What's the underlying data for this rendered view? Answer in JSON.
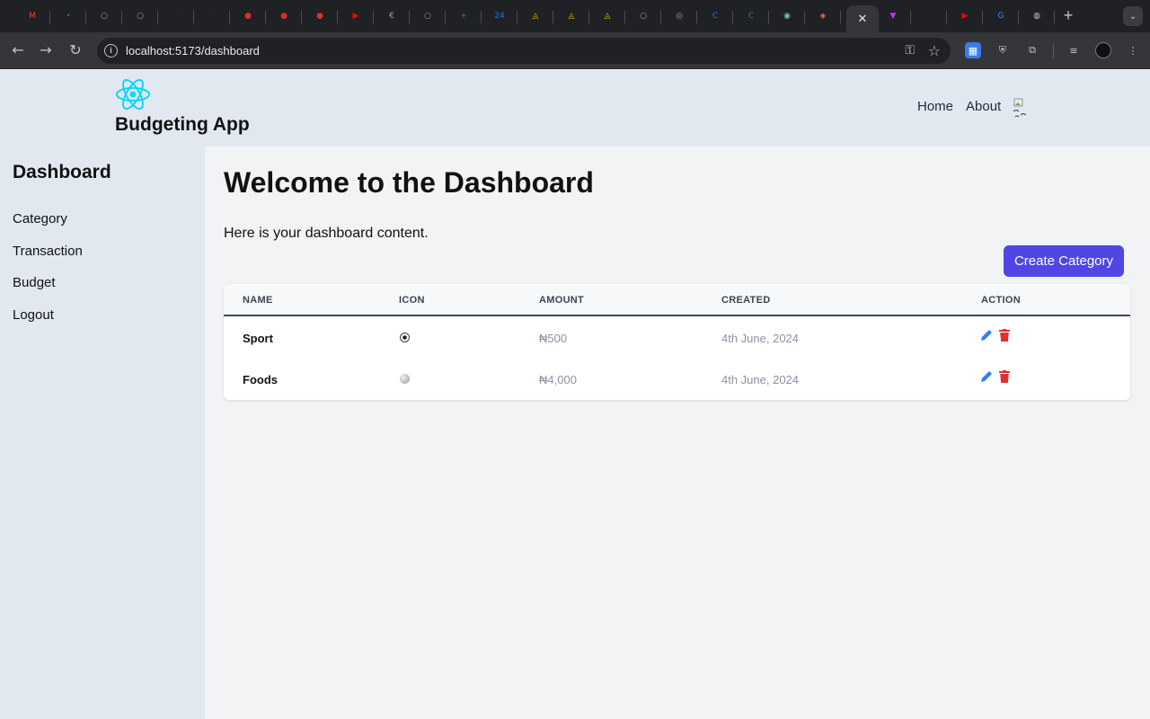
{
  "browser": {
    "tabs": [
      {
        "icon": "gmail-icon",
        "color": "#ea4335",
        "glyph": "M"
      },
      {
        "icon": "site-icon",
        "color": "#1a7f4b",
        "glyph": "•"
      },
      {
        "icon": "loading-icon",
        "color": "#9aa0a6",
        "glyph": "○"
      },
      {
        "icon": "loading-icon",
        "color": "#9aa0a6",
        "glyph": "○"
      },
      {
        "icon": "site-icon",
        "color": "#3a3a3a",
        "glyph": "·"
      },
      {
        "icon": "site-icon",
        "color": "#3a3a3a",
        "glyph": "·"
      },
      {
        "icon": "record-icon",
        "color": "#d93025",
        "glyph": "●"
      },
      {
        "icon": "record-icon",
        "color": "#d93025",
        "glyph": "●"
      },
      {
        "icon": "record-icon",
        "color": "#d93025",
        "glyph": "●"
      },
      {
        "icon": "youtube-icon",
        "color": "#ff0000",
        "glyph": "▶"
      },
      {
        "icon": "site-icon",
        "color": "#9aa0a6",
        "glyph": "€"
      },
      {
        "icon": "loading-icon",
        "color": "#9aa0a6",
        "glyph": "○"
      },
      {
        "icon": "sheets-icon",
        "color": "#1e8e3e",
        "glyph": "+"
      },
      {
        "icon": "calendar-icon",
        "color": "#1a73e8",
        "glyph": "24"
      },
      {
        "icon": "drive-icon",
        "color": "#fbbc04",
        "glyph": "◬"
      },
      {
        "icon": "drive-icon",
        "color": "#fbbc04",
        "glyph": "◬"
      },
      {
        "icon": "drive-icon",
        "color": "#fbbc04",
        "glyph": "◬"
      },
      {
        "icon": "loading-icon",
        "color": "#9aa0a6",
        "glyph": "○"
      },
      {
        "icon": "site-icon",
        "color": "#9aa0a6",
        "glyph": "◎"
      },
      {
        "icon": "c-icon",
        "color": "#1a73e8",
        "glyph": "C"
      },
      {
        "icon": "c-icon",
        "color": "#1a73e8",
        "glyph": "C"
      },
      {
        "icon": "site-icon",
        "color": "#81c995",
        "glyph": "◉"
      },
      {
        "icon": "site-icon",
        "color": "#d97757",
        "glyph": "◈"
      }
    ],
    "active_tab_close": "✕",
    "tabs_after": [
      {
        "icon": "vite-icon",
        "color": "#bd34fe",
        "glyph": "▼"
      },
      {
        "icon": "site-icon",
        "color": "#35363a",
        "glyph": ""
      },
      {
        "icon": "youtube-icon",
        "color": "#ff0000",
        "glyph": "▶"
      },
      {
        "icon": "google-icon",
        "color": "#4285f4",
        "glyph": "G"
      },
      {
        "icon": "globe-icon",
        "color": "#c4c7cc",
        "glyph": "◍"
      }
    ],
    "new_tab": "+",
    "url": "localhost:5173/dashboard"
  },
  "header": {
    "brand": "Budgeting App",
    "nav": [
      "Home",
      "About"
    ],
    "accent": "#00d8ff"
  },
  "sidebar": {
    "title": "Dashboard",
    "items": [
      "Category",
      "Transaction",
      "Budget",
      "Logout"
    ]
  },
  "main": {
    "title": "Welcome to the Dashboard",
    "subtitle": "Here is your dashboard content.",
    "create_button": "Create Category",
    "button_color": "#4f46e5",
    "table": {
      "headers": [
        "NAME",
        "ICON",
        "AMOUNT",
        "CREATED",
        "ACTION"
      ],
      "rows": [
        {
          "name": "Sport",
          "icon": "soccer-ball-icon",
          "amount": "₦500",
          "created": "4th June, 2024"
        },
        {
          "name": "Foods",
          "icon": "foods-icon",
          "amount": "₦4,000",
          "created": "4th June, 2024"
        }
      ]
    }
  }
}
